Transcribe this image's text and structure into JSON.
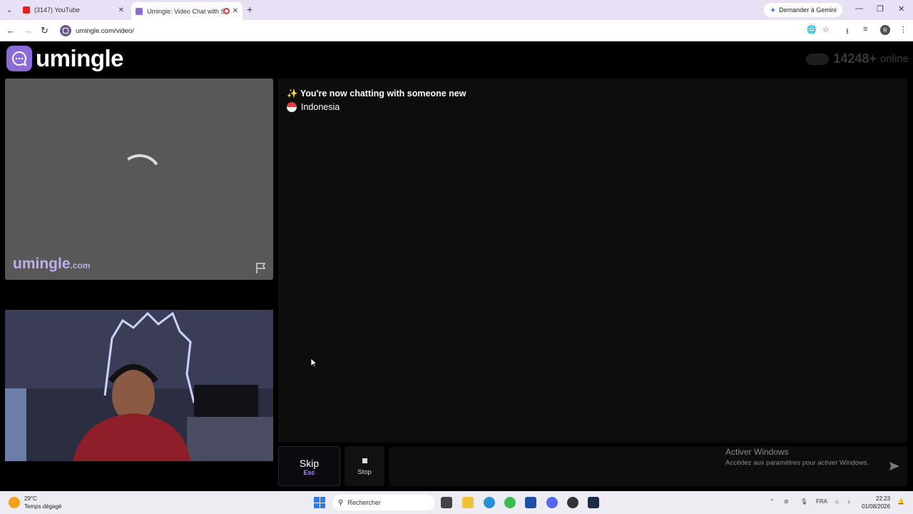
{
  "browser": {
    "tabs": [
      {
        "title": "(3147) YouTube"
      },
      {
        "title": "Umingle: Video Chat with S"
      }
    ],
    "gemini_label": "Demander à Gemini",
    "url": "umingle.com/video/",
    "profile_initial": "R"
  },
  "site": {
    "logo_text": "umingle",
    "online_count": "14248+",
    "online_label": "online"
  },
  "stranger_video": {
    "watermark": "umingle",
    "watermark_suffix": ".com"
  },
  "chat": {
    "status_emoji": "✨",
    "status_message": "You're now chatting with someone new",
    "country": "Indonesia"
  },
  "controls": {
    "skip_label": "Skip",
    "skip_hotkey": "Esc",
    "stop_label": "Stop",
    "message_placeholder": ""
  },
  "windows_activation": {
    "title": "Activer Windows",
    "subtitle": "Accédez aux paramètres pour activer Windows."
  },
  "taskbar": {
    "temperature": "29°C",
    "weather": "Temps dégagé",
    "search_placeholder": "Rechercher",
    "language": "FRA",
    "time": "22:23",
    "date": "01/08/2026"
  },
  "colors": {
    "brand_purple": "#8b6bd8",
    "watermark_purple": "#c0aee8",
    "hotkey_purple": "#b98cf0"
  }
}
